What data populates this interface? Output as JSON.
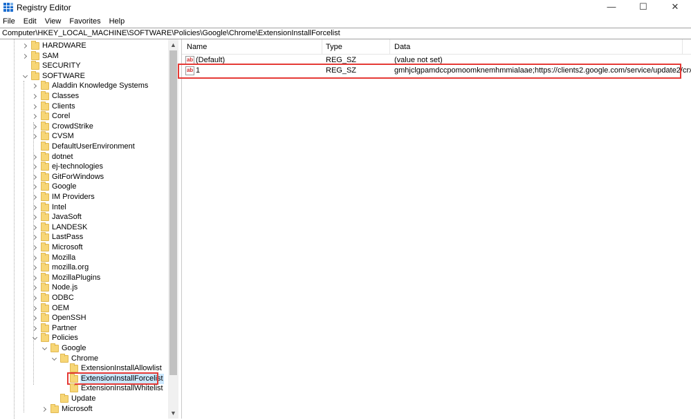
{
  "window": {
    "title": "Registry Editor",
    "minimize": "—",
    "maximize": "☐",
    "close": "✕"
  },
  "menu": [
    "File",
    "Edit",
    "View",
    "Favorites",
    "Help"
  ],
  "address": "Computer\\HKEY_LOCAL_MACHINE\\SOFTWARE\\Policies\\Google\\Chrome\\ExtensionInstallForcelist",
  "tree": [
    {
      "label": "HARDWARE",
      "depth": 1,
      "exp": ">"
    },
    {
      "label": "SAM",
      "depth": 1,
      "exp": ">"
    },
    {
      "label": "SECURITY",
      "depth": 1,
      "exp": ""
    },
    {
      "label": "SOFTWARE",
      "depth": 1,
      "exp": "v"
    },
    {
      "label": "Aladdin Knowledge Systems",
      "depth": 2,
      "exp": ">"
    },
    {
      "label": "Classes",
      "depth": 2,
      "exp": ">"
    },
    {
      "label": "Clients",
      "depth": 2,
      "exp": ">"
    },
    {
      "label": "Corel",
      "depth": 2,
      "exp": ">"
    },
    {
      "label": "CrowdStrike",
      "depth": 2,
      "exp": ">"
    },
    {
      "label": "CVSM",
      "depth": 2,
      "exp": ">"
    },
    {
      "label": "DefaultUserEnvironment",
      "depth": 2,
      "exp": ""
    },
    {
      "label": "dotnet",
      "depth": 2,
      "exp": ">"
    },
    {
      "label": "ej-technologies",
      "depth": 2,
      "exp": ">"
    },
    {
      "label": "GitForWindows",
      "depth": 2,
      "exp": ">"
    },
    {
      "label": "Google",
      "depth": 2,
      "exp": ">"
    },
    {
      "label": "IM Providers",
      "depth": 2,
      "exp": ">"
    },
    {
      "label": "Intel",
      "depth": 2,
      "exp": ">"
    },
    {
      "label": "JavaSoft",
      "depth": 2,
      "exp": ">"
    },
    {
      "label": "LANDESK",
      "depth": 2,
      "exp": ">"
    },
    {
      "label": "LastPass",
      "depth": 2,
      "exp": ">"
    },
    {
      "label": "Microsoft",
      "depth": 2,
      "exp": ">"
    },
    {
      "label": "Mozilla",
      "depth": 2,
      "exp": ">"
    },
    {
      "label": "mozilla.org",
      "depth": 2,
      "exp": ">"
    },
    {
      "label": "MozillaPlugins",
      "depth": 2,
      "exp": ">"
    },
    {
      "label": "Node.js",
      "depth": 2,
      "exp": ">"
    },
    {
      "label": "ODBC",
      "depth": 2,
      "exp": ">"
    },
    {
      "label": "OEM",
      "depth": 2,
      "exp": ">"
    },
    {
      "label": "OpenSSH",
      "depth": 2,
      "exp": ">"
    },
    {
      "label": "Partner",
      "depth": 2,
      "exp": ">"
    },
    {
      "label": "Policies",
      "depth": 2,
      "exp": "v"
    },
    {
      "label": "Google",
      "depth": 3,
      "exp": "v"
    },
    {
      "label": "Chrome",
      "depth": 4,
      "exp": "v"
    },
    {
      "label": "ExtensionInstallAllowlist",
      "depth": 5,
      "exp": ""
    },
    {
      "label": "ExtensionInstallForcelist",
      "depth": 5,
      "exp": "",
      "selected": true
    },
    {
      "label": "ExtensionInstallWhitelist",
      "depth": 5,
      "exp": ""
    },
    {
      "label": "Update",
      "depth": 4,
      "exp": ""
    },
    {
      "label": "Microsoft",
      "depth": 3,
      "exp": ">"
    }
  ],
  "values": {
    "headers": {
      "name": "Name",
      "type": "Type",
      "data": "Data"
    },
    "icon_text": "ab",
    "rows": [
      {
        "name": "(Default)",
        "type": "REG_SZ",
        "data": "(value not set)"
      },
      {
        "name": "1",
        "type": "REG_SZ",
        "data": "gmhjclgpamdccpomoomknemhmmialaae;https://clients2.google.com/service/update2/crx",
        "highlighted": true
      }
    ]
  },
  "colors": {
    "highlight": "#e53935",
    "selection": "#cce8ff"
  }
}
